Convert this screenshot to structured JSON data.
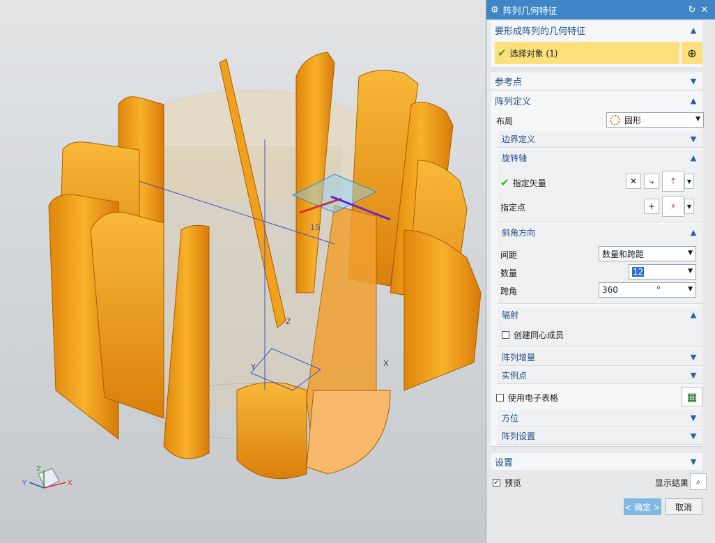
{
  "dialog": {
    "title": "阵列几何特征",
    "reset_icon": "reset-icon",
    "close_icon": "close-icon"
  },
  "geometry_group": {
    "title": "要形成阵列的几何特征",
    "select_label": "选择对象 (1)"
  },
  "ref_point_group": {
    "title": "参考点"
  },
  "array_def_group": {
    "title": "阵列定义",
    "layout_label": "布局",
    "layout_value": "圆形",
    "boundary_title": "边界定义",
    "rotation_axis_title": "旋转轴",
    "specify_vector_label": "指定矢量",
    "specify_point_label": "指定点",
    "angle_dir_title": "斜角方向",
    "spacing_label": "间距",
    "spacing_value": "数量和跨距",
    "count_label": "数量",
    "count_value": "12",
    "span_label": "跨角",
    "span_value": "360",
    "span_unit": "°",
    "radiate_title": "辐射",
    "concentric_label": "创建同心成员",
    "increment_title": "阵列增量",
    "instance_title": "实例点",
    "spreadsheet_label": "使用电子表格",
    "orientation_title": "方位",
    "array_settings_title": "阵列设置"
  },
  "settings_group": {
    "title": "设置"
  },
  "footer": {
    "preview_label": "预览",
    "show_result_label": "显示结果",
    "ok_label": "< 确定 >",
    "cancel_label": "取消"
  },
  "viewport": {
    "axis_x": "X",
    "axis_y": "Y",
    "axis_z": "Z",
    "dimension": "15"
  },
  "colors": {
    "accent": "#3e86c6",
    "selection_highlight": "#fde07c",
    "part_orange": "#f4a21a",
    "check_green": "#3aa62b"
  }
}
